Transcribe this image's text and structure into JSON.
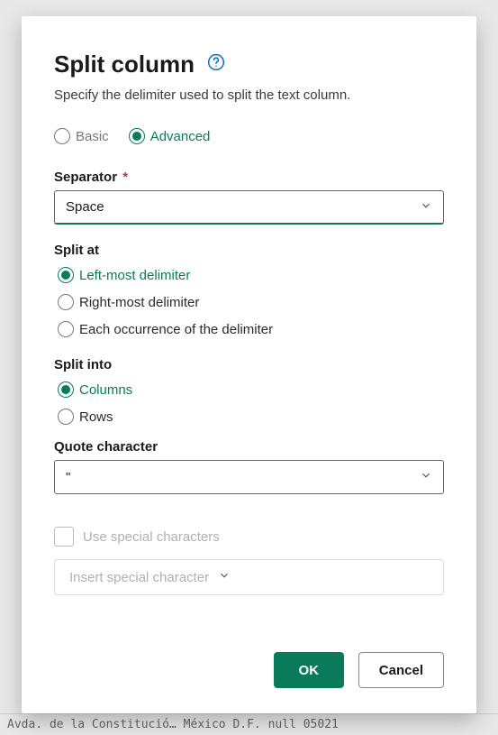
{
  "dialog": {
    "title": "Split column",
    "subtitle": "Specify the delimiter used to split the text column."
  },
  "mode": {
    "basic": "Basic",
    "advanced": "Advanced",
    "selected": "advanced"
  },
  "separator": {
    "label": "Separator",
    "required": "*",
    "value": "Space"
  },
  "split_at": {
    "label": "Split at",
    "options": {
      "left": "Left-most delimiter",
      "right": "Right-most delimiter",
      "each": "Each occurrence of the delimiter"
    },
    "selected": "left"
  },
  "split_into": {
    "label": "Split into",
    "options": {
      "columns": "Columns",
      "rows": "Rows"
    },
    "selected": "columns"
  },
  "quote": {
    "label": "Quote character",
    "value": "\""
  },
  "special": {
    "checkbox_label": "Use special characters",
    "insert_label": "Insert special character"
  },
  "buttons": {
    "ok": "OK",
    "cancel": "Cancel"
  },
  "background": {
    "text": "Avda. de la Constitució… México D.F.          null 05021"
  }
}
